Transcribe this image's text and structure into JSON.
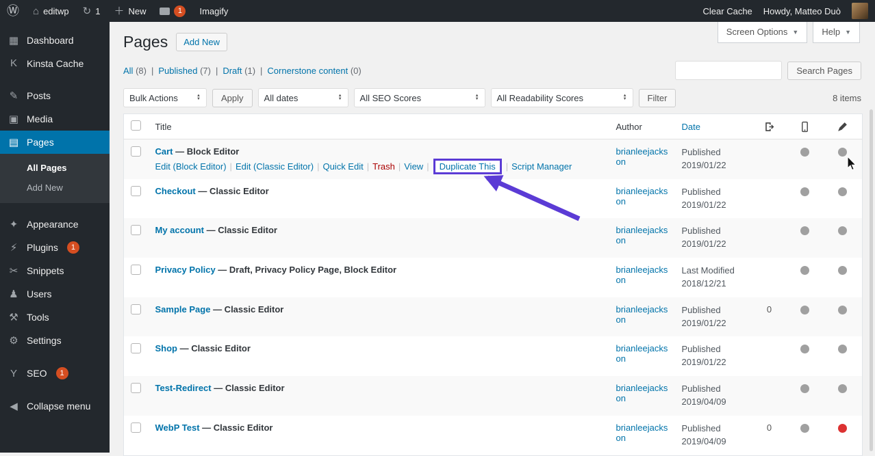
{
  "admin_bar": {
    "site_name": "editwp",
    "updates_count": "1",
    "new_label": "New",
    "comments_count": "1",
    "imagify_label": "Imagify",
    "clear_cache_label": "Clear Cache",
    "howdy_label": "Howdy, Matteo Duò"
  },
  "sidebar": {
    "items": [
      {
        "id": "dashboard",
        "label": "Dashboard",
        "icon": "dashboard-icon",
        "glyph": "▦"
      },
      {
        "id": "kinsta-cache",
        "label": "Kinsta Cache",
        "icon": "kinsta-icon",
        "glyph": "K",
        "gap_after": true
      },
      {
        "id": "posts",
        "label": "Posts",
        "icon": "pin-icon",
        "glyph": "✎"
      },
      {
        "id": "media",
        "label": "Media",
        "icon": "media-icon",
        "glyph": "▣"
      },
      {
        "id": "pages",
        "label": "Pages",
        "icon": "pages-icon",
        "glyph": "▤",
        "active": true,
        "gap_after": true,
        "submenu": [
          {
            "label": "All Pages",
            "current": true
          },
          {
            "label": "Add New",
            "current": false
          }
        ]
      },
      {
        "id": "appearance",
        "label": "Appearance",
        "icon": "brush-icon",
        "glyph": "✦"
      },
      {
        "id": "plugins",
        "label": "Plugins",
        "icon": "plugin-icon",
        "glyph": "⚡",
        "badge": "1"
      },
      {
        "id": "snippets",
        "label": "Snippets",
        "icon": "scissors-icon",
        "glyph": "✂"
      },
      {
        "id": "users",
        "label": "Users",
        "icon": "user-icon",
        "glyph": "♟"
      },
      {
        "id": "tools",
        "label": "Tools",
        "icon": "tools-icon",
        "glyph": "⚒"
      },
      {
        "id": "settings",
        "label": "Settings",
        "icon": "gear-icon",
        "glyph": "⚙",
        "gap_after": true
      },
      {
        "id": "seo",
        "label": "SEO",
        "icon": "yoast-icon",
        "glyph": "Y",
        "badge": "1",
        "gap_after": true
      },
      {
        "id": "collapse",
        "label": "Collapse menu",
        "icon": "collapse-arrow-icon",
        "glyph": "◀"
      }
    ]
  },
  "screen_tabs": {
    "screen_options": "Screen Options",
    "help": "Help"
  },
  "page": {
    "title": "Pages",
    "add_new_label": "Add New",
    "filters": [
      {
        "label": "All",
        "count": "(8)"
      },
      {
        "label": "Published",
        "count": "(7)"
      },
      {
        "label": "Draft",
        "count": "(1)"
      },
      {
        "label": "Cornerstone content",
        "count": "(0)"
      }
    ],
    "search_button_label": "Search Pages",
    "items_count": "8 items"
  },
  "tablenav": {
    "bulk_actions": "Bulk Actions",
    "apply_label": "Apply",
    "all_dates": "All dates",
    "all_seo_scores": "All SEO Scores",
    "all_readability_scores": "All Readability Scores",
    "filter_label": "Filter"
  },
  "table": {
    "headers": {
      "title": "Title",
      "author": "Author",
      "date": "Date"
    },
    "icon_columns": [
      "scripts-column",
      "mobile-column",
      "seo-column"
    ],
    "rows": [
      {
        "title": "Cart",
        "state": "— Block Editor",
        "author": "brianleejackson",
        "date_line1": "Published",
        "date_line2": "2019/01/22",
        "links": "",
        "dot1": "gray",
        "dot2": "gray",
        "actions": [
          {
            "label": "Edit (Block Editor)",
            "type": "default"
          },
          {
            "label": "Edit (Classic Editor)",
            "type": "default"
          },
          {
            "label": "Quick Edit",
            "type": "default"
          },
          {
            "label": "Trash",
            "type": "trash"
          },
          {
            "label": "View",
            "type": "default"
          },
          {
            "label": "Duplicate This",
            "type": "highlight"
          },
          {
            "label": "Script Manager",
            "type": "default"
          }
        ]
      },
      {
        "title": "Checkout",
        "state": "— Classic Editor",
        "author": "brianleejackson",
        "date_line1": "Published",
        "date_line2": "2019/01/22",
        "links": "",
        "dot1": "gray",
        "dot2": "gray"
      },
      {
        "title": "My account",
        "state": "— Classic Editor",
        "author": "brianleejackson",
        "date_line1": "Published",
        "date_line2": "2019/01/22",
        "links": "",
        "dot1": "gray",
        "dot2": "gray"
      },
      {
        "title": "Privacy Policy",
        "state": "— Draft, Privacy Policy Page, Block Editor",
        "author": "brianleejackson",
        "date_line1": "Last Modified",
        "date_line2": "2018/12/21",
        "links": "",
        "dot1": "gray",
        "dot2": "gray"
      },
      {
        "title": "Sample Page",
        "state": "— Classic Editor",
        "author": "brianleejackson",
        "date_line1": "Published",
        "date_line2": "2019/01/22",
        "links": "0",
        "dot1": "gray",
        "dot2": "gray"
      },
      {
        "title": "Shop",
        "state": "— Classic Editor",
        "author": "brianleejackson",
        "date_line1": "Published",
        "date_line2": "2019/01/22",
        "links": "",
        "dot1": "gray",
        "dot2": "gray"
      },
      {
        "title": "Test-Redirect",
        "state": "— Classic Editor",
        "author": "brianleejackson",
        "date_line1": "Published",
        "date_line2": "2019/04/09",
        "links": "",
        "dot1": "gray",
        "dot2": "gray"
      },
      {
        "title": "WebP Test",
        "state": "— Classic Editor",
        "author": "brianleejackson",
        "date_line1": "Published",
        "date_line2": "2019/04/09",
        "links": "0",
        "dot1": "gray",
        "dot2": "red"
      }
    ]
  },
  "annotation": {
    "color": "#5b3bd5"
  }
}
